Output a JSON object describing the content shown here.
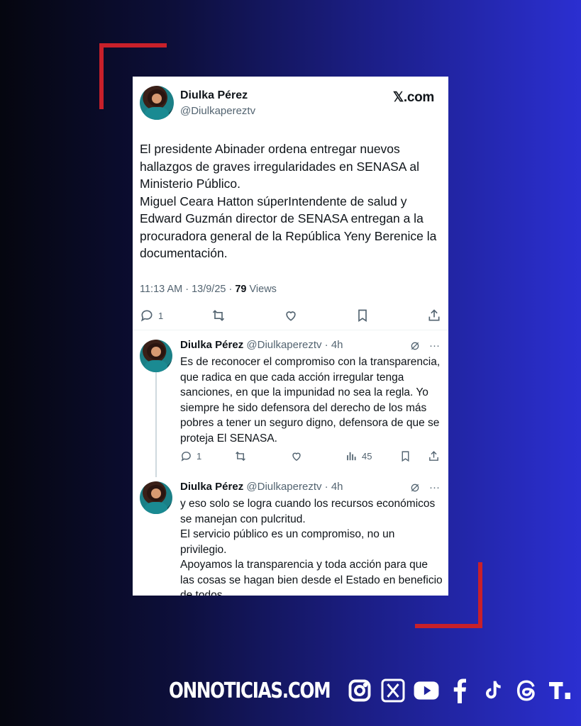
{
  "tweet": {
    "author_name": "Diulka Pérez",
    "author_handle": "@Diulkapereztv",
    "source_logo": "𝕏.com",
    "text": "El presidente Abinader ordena entregar nuevos hallazgos de graves irregularidades en SENASA al Ministerio Público.\nMiguel Ceara Hatton súperIntendente de salud y Edward Guzmán director de SENASA entregan a la procuradora general de la República Yeny Berenice la documentación.",
    "timestamp": "11:13 AM · 13/9/25 · ",
    "views_count": "79",
    "views_label": " Views",
    "replies_count": "1"
  },
  "replies": [
    {
      "author_name": "Diulka Pérez",
      "author_handle": "@Diulkapereztv · 4h",
      "text": "Es de reconocer el compromiso con la transparencia, que  radica en que cada acción irregular tenga sanciones, en que la impunidad no sea la regla. Yo siempre he sido defensora del derecho de los más pobres a tener un seguro digno, defensora de que se proteja El SENASA.",
      "replies_count": "1",
      "views_count": "45"
    },
    {
      "author_name": "Diulka Pérez",
      "author_handle": "@Diulkapereztv · 4h",
      "text": "y eso solo se logra cuando los recursos económicos se manejan con pulcritud.\nEl servicio público es un compromiso, no un privilegio.\nApoyamos la transparencia y toda acción para que las cosas se hagan bien desde el Estado en beneficio de todos."
    }
  ],
  "footer": {
    "brand": "ONNOTICIAS.COM",
    "social_icons": [
      "instagram-icon",
      "x-icon",
      "youtube-icon",
      "facebook-icon",
      "tiktok-icon",
      "threads-icon",
      "telegram-t-icon"
    ]
  },
  "colors": {
    "accent_red": "#c8202a",
    "background_dark": "#05060f",
    "background_blue": "#2b2fd1",
    "muted_text": "#536471"
  }
}
